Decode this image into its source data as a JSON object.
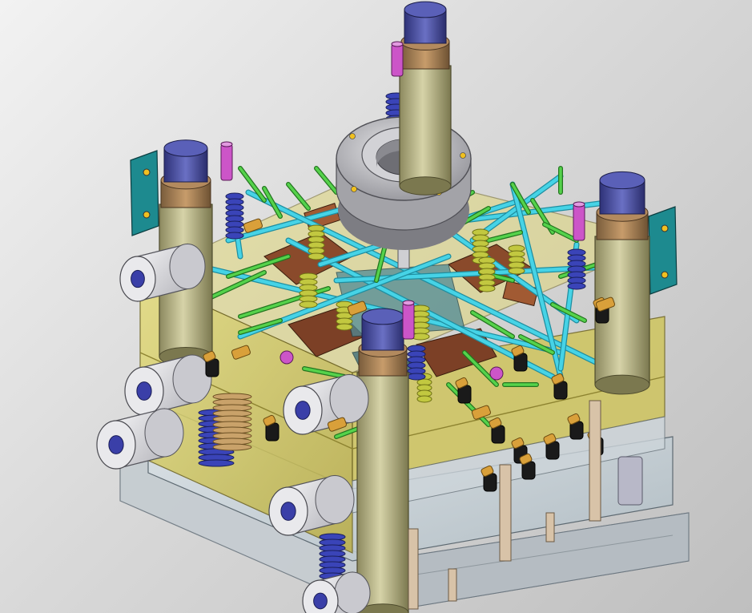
{
  "scene": {
    "subject": "cad-model",
    "palette": {
      "plate": "#d7cf6a",
      "plate_shade": "#b9ae45",
      "glass": "#c9d6dd",
      "cylinder_body": "#b5b183",
      "cylinder_collar": "#a0805a",
      "cylinder_cap": "#4a4f9c",
      "water_line": "#46d3e6",
      "green_pin": "#55d24b",
      "spring": "#c2c840",
      "blue_spring": "#3a44b8",
      "fitting": "#1a1a1a",
      "brass": "#d9a03a",
      "bracket": "#1d8a8f",
      "manifold": "#c8c8cb",
      "rust": "#8a4a2b",
      "magenta": "#cc55c8",
      "connector": "#dcdce0"
    }
  }
}
